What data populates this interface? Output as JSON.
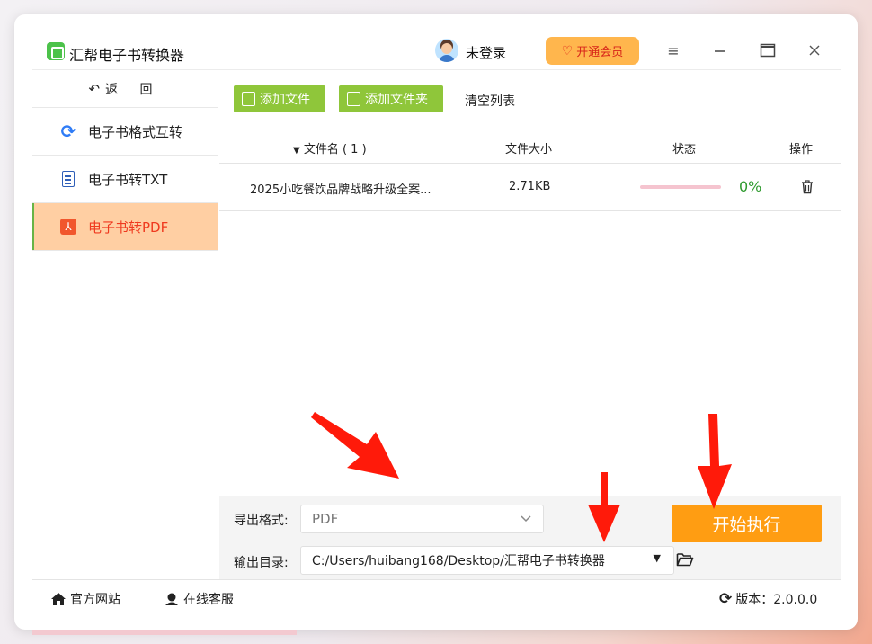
{
  "app": {
    "title": "汇帮电子书转换器"
  },
  "header": {
    "login_label": "未登录",
    "vip_label": "开通会员",
    "menu_icon": "hamburger-icon",
    "minimize_icon": "minimize-icon",
    "maximize_icon": "maximize-icon",
    "close_icon": "close-icon"
  },
  "sidebar": {
    "back_label": "返 回",
    "items": [
      {
        "label": "电子书格式互转",
        "icon": "swap-icon",
        "active": false
      },
      {
        "label": "电子书转TXT",
        "icon": "document-icon",
        "active": false
      },
      {
        "label": "电子书转PDF",
        "icon": "pdf-icon",
        "active": true
      }
    ]
  },
  "toolbar": {
    "add_file_label": "添加文件",
    "add_folder_label": "添加文件夹",
    "clear_label": "清空列表"
  },
  "table": {
    "headers": {
      "filename": "文件名 ( 1 )",
      "size": "文件大小",
      "status": "状态",
      "action": "操作"
    },
    "rows": [
      {
        "filename": "2025小吃餐饮品牌战略升级全案...",
        "size": "2.71KB",
        "progress": 0,
        "percent": "0%"
      }
    ]
  },
  "options": {
    "format_label": "导出格式:",
    "format_value": "PDF",
    "output_label": "输出目录:",
    "output_value": "C:/Users/huibang168/Desktop/汇帮电子书转换器"
  },
  "start_button": "开始执行",
  "footer": {
    "website": "官方网站",
    "support": "在线客服",
    "version": "版本：2.0.0.0"
  },
  "colors": {
    "accent_green": "#8fc63a",
    "accent_orange": "#ff9d12",
    "active_bg": "#ffcfa3",
    "active_text": "#ef3a1f",
    "arrow_red": "#ff1a0a"
  }
}
